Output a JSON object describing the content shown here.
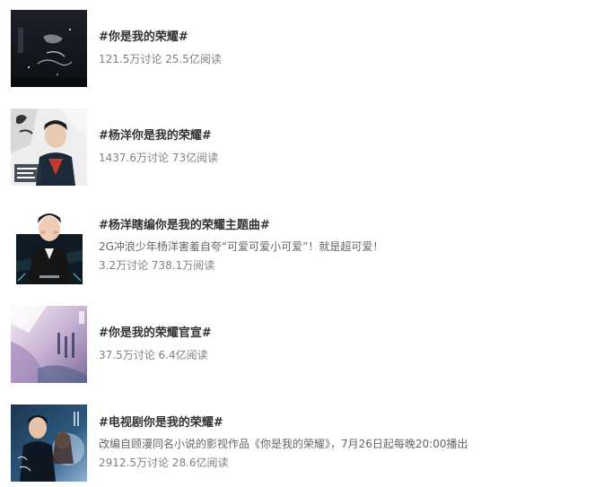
{
  "topics": [
    {
      "title": "#你是我的荣耀#",
      "description": "",
      "stats": "121.5万讨论 25.5亿阅读",
      "thumbnail_icon": "dark-poster-thumbnail"
    },
    {
      "title": "#杨洋你是我的荣耀#",
      "description": "",
      "stats": "1437.6万讨论 73亿阅读",
      "thumbnail_icon": "actor-poster-thumbnail"
    },
    {
      "title": "#杨洋瞎编你是我的荣耀主题曲#",
      "description": "2G冲浪少年杨洋害羞自夸“可爱可爱小可爱”！就是超可爱！",
      "stats": "3.2万讨论 738.1万阅读",
      "thumbnail_icon": "actor-video-thumbnail"
    },
    {
      "title": "#你是我的荣耀官宣#",
      "description": "",
      "stats": "37.5万讨论 6.4亿阅读",
      "thumbnail_icon": "announcement-poster-thumbnail"
    },
    {
      "title": "#电视剧你是我的荣耀#",
      "description": "改编自顾漫同名小说的影视作品《你是我的荣耀》，7月26日起每晚20:00播出",
      "stats": "2912.5万讨论 28.6亿阅读",
      "thumbnail_icon": "drama-poster-thumbnail"
    }
  ]
}
